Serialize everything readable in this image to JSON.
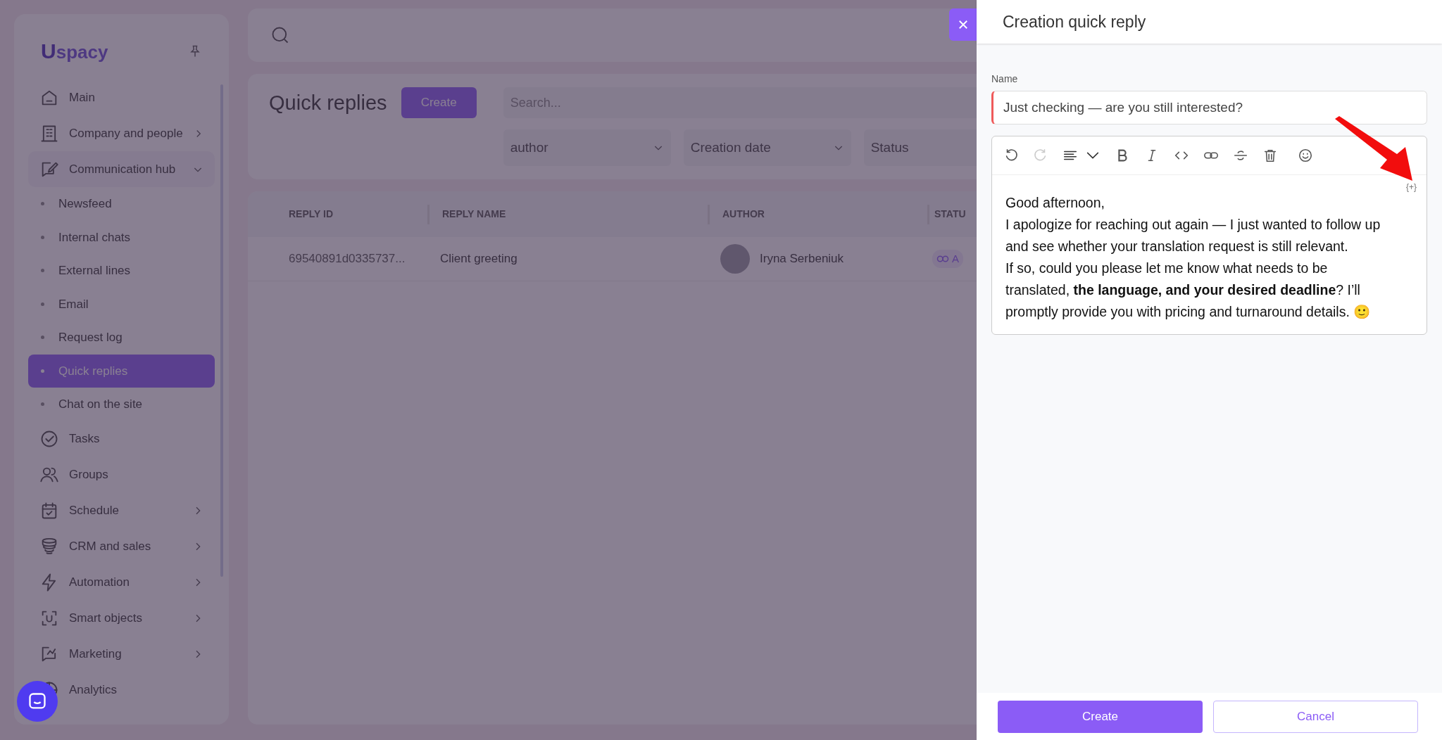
{
  "sidebar": {
    "logo": {
      "mark": "U",
      "text": "spacy"
    },
    "items": [
      {
        "label": "Main",
        "kind": "link",
        "selected": false
      },
      {
        "label": "Company and people",
        "kind": "group",
        "expanded": false,
        "selected": false
      },
      {
        "label": "Communication hub",
        "kind": "group",
        "expanded": true,
        "selected": false,
        "children": [
          {
            "label": "Newsfeed",
            "selected": false
          },
          {
            "label": "Internal chats",
            "selected": false
          },
          {
            "label": "External lines",
            "selected": false
          },
          {
            "label": "Email",
            "selected": false
          },
          {
            "label": "Request log",
            "selected": false
          },
          {
            "label": "Quick replies",
            "selected": true
          },
          {
            "label": "Chat on the site",
            "selected": false
          }
        ]
      },
      {
        "label": "Tasks",
        "kind": "link",
        "selected": false
      },
      {
        "label": "Groups",
        "kind": "link",
        "selected": false
      },
      {
        "label": "Schedule",
        "kind": "group",
        "expanded": false,
        "selected": false
      },
      {
        "label": "CRM and sales",
        "kind": "group",
        "expanded": false,
        "selected": false
      },
      {
        "label": "Automation",
        "kind": "group",
        "expanded": false,
        "selected": false
      },
      {
        "label": "Smart objects",
        "kind": "group",
        "expanded": false,
        "selected": false
      },
      {
        "label": "Marketing",
        "kind": "group",
        "expanded": false,
        "selected": false
      },
      {
        "label": "Analytics",
        "kind": "link",
        "selected": false
      }
    ]
  },
  "page": {
    "title": "Quick replies",
    "create_button": "Create",
    "search": {
      "placeholder": "Search..."
    },
    "filters": [
      "author",
      "Creation date",
      "Status"
    ],
    "table": {
      "columns": [
        "REPLY ID",
        "REPLY NAME",
        "AUTHOR",
        "STATU"
      ],
      "rows": [
        {
          "reply_id": "69540891d0335737...",
          "reply_name": "Client greeting",
          "author": "Iryna Serbeniuk",
          "status": "A"
        }
      ]
    }
  },
  "panel": {
    "title": "Creation quick reply",
    "name_label": "Name",
    "name_value": "Just checking — are you still interested?",
    "editor": {
      "variable_button": "{+}",
      "paragraphs": [
        "Good afternoon,",
        "I apologize for reaching out again — I just wanted to follow up and see whether your translation request is still relevant.",
        "If so, could you please let me know what needs to be translated, **the language, and your desired deadline**? I’ll promptly provide you with pricing and turnaround details. 🙂"
      ]
    },
    "buttons": [
      {
        "label": "Create",
        "kind": "primary"
      },
      {
        "label": "Cancel",
        "kind": "secondary"
      }
    ]
  }
}
